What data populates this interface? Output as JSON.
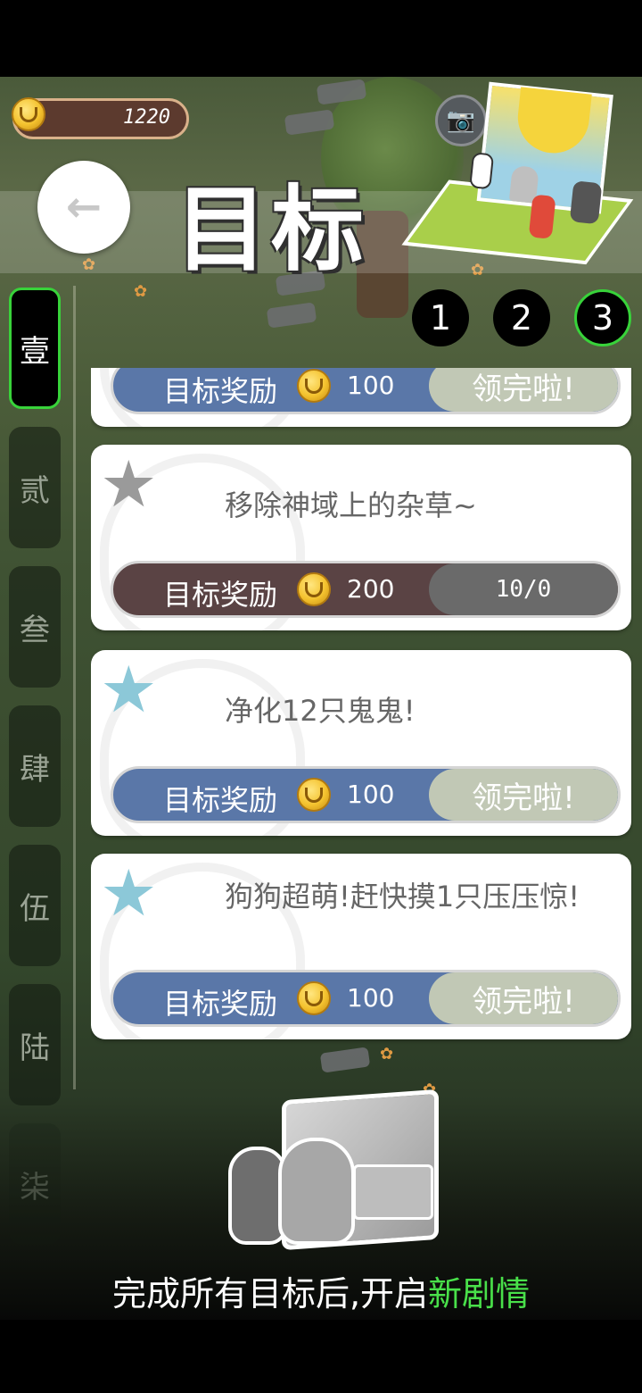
{
  "header": {
    "coins": "1220",
    "title": "目标",
    "back_icon": "←",
    "camera_icon": "📷"
  },
  "sidebar": {
    "tabs": [
      {
        "label": "壹",
        "active": true
      },
      {
        "label": "贰",
        "active": false
      },
      {
        "label": "叁",
        "active": false
      },
      {
        "label": "肆",
        "active": false
      },
      {
        "label": "伍",
        "active": false
      },
      {
        "label": "陆",
        "active": false
      },
      {
        "label": "柒",
        "active": false
      }
    ]
  },
  "levels": [
    {
      "label": "1",
      "active": false
    },
    {
      "label": "2",
      "active": false
    },
    {
      "label": "3",
      "active": true
    }
  ],
  "goals": [
    {
      "desc": "",
      "reward_label": "目标奖励",
      "reward": "100",
      "status": "领完啦!",
      "state": "done",
      "star_color": "#8cc8d8"
    },
    {
      "desc": "移除神域上的杂草~",
      "reward_label": "目标奖励",
      "reward": "200",
      "status": "10/0",
      "state": "progress",
      "star_color": "#9a9a9a"
    },
    {
      "desc": "净化12只鬼鬼!",
      "reward_label": "目标奖励",
      "reward": "100",
      "status": "领完啦!",
      "state": "done",
      "star_color": "#8cc8d8"
    },
    {
      "desc": "狗狗超萌!赶快摸1只压压惊!",
      "reward_label": "目标奖励",
      "reward": "100",
      "status": "领完啦!",
      "state": "done",
      "star_color": "#8cc8d8"
    }
  ],
  "footer": {
    "text_main": "完成所有目标后,开启",
    "text_highlight": "新剧情"
  },
  "colors": {
    "accent_green": "#38d33a",
    "highlight_green": "#49e04a",
    "reward_blue": "#5a77a8",
    "reward_dark": "#5a4344"
  }
}
